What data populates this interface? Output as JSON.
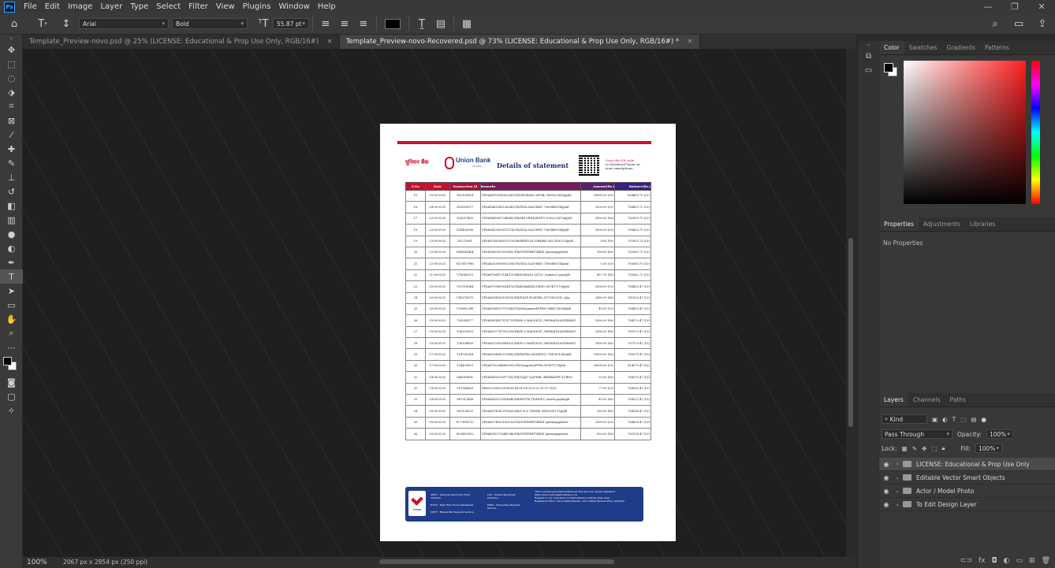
{
  "menu": [
    "File",
    "Edit",
    "Image",
    "Layer",
    "Type",
    "Select",
    "Filter",
    "View",
    "Plugins",
    "Window",
    "Help"
  ],
  "options": {
    "font_family": "Arial",
    "font_style": "Bold",
    "font_size": "55.87 pt"
  },
  "tabs": [
    {
      "label": "Template_Preview-novo.psd @ 25% (LICENSE: Educational & Prop Use Only, RGB/16#)",
      "active": false
    },
    {
      "label": "Template_Preview-novo-Recovered.psd @ 73% (LICENSE: Educational & Prop Use Only, RGB/16#) *",
      "active": true
    }
  ],
  "status": {
    "zoom": "100%",
    "doc_info": "2067 px x 2854 px (250 ppi)"
  },
  "statement": {
    "bank_hindi": "यूनियन बैंक",
    "bank_en": "Union Bank",
    "bank_en_sub": "of India",
    "title": "Details of statement",
    "qr_line1": "Scan the QR code",
    "qr_line2": "to download Vyom on",
    "qr_line3": "your smartphone",
    "headers": [
      "S.No",
      "Date",
      "Transaction Id",
      "Remarks",
      "Amount(Rs.)",
      "Balance(Rs.)"
    ],
    "rows": [
      [
        "15",
        "25-08-2025",
        "X50100814",
        "UPIAR/090104282941/CR/VENKATA /APGB/ 9989229618@ybl",
        "50000.00 (Cr)",
        "834455.73 (Cr)"
      ],
      [
        "16",
        "24-08-2025",
        "X29859517",
        "UPIAR/485545136543/CR/SIVA SAI/UBIN/ 7569488514@axl",
        "1500.00 (Cr)",
        "784455.73 (Cr)"
      ],
      [
        "17",
        "23-08-2025",
        "X28357400",
        "UPIAR/849067248441/DR/SRI VENK/HDFC/ 6302233076@ybl",
        "5500.00 (Dr)",
        "782955.73 (Cr)"
      ],
      [
        "18",
        "23-08-2025",
        "X28492096",
        "UPIAR/453509031114/CR/SIVA SAI/UBIN/ 7569488514@ybl",
        "5500.00 (Cr)",
        "788455.73 (Cr)"
      ],
      [
        "19",
        "23-08-2025",
        "X5275361",
        "UPIAR/746148015379/DR/MERUVA V/BARB/ Q427436733@ybl",
        "8.00 (Dr)",
        "782955.73 (Cr)"
      ],
      [
        "20",
        "22-08-2025",
        "W46048404",
        "UPIAR/985929095492/DR/GOPISHET/BKID /paramgopishet",
        "100.00 (Dr)",
        "782963.73 (Cr)"
      ],
      [
        "21",
        "22-08-2025",
        "W37497986",
        "UPIAR/353908051508/CR/SIVA SAI/UBIN/ 7569488514@axl",
        "1.00 (Cr)",
        "783063.73 (Cr)"
      ],
      [
        "22",
        "21-08-2025",
        "V78045915",
        "UPIAR/766872144513/DR/ZOMATO L/ICIC /zomato1 payu@b",
        "457.76 (Dr)",
        "783062.73 (Cr)"
      ],
      [
        "23",
        "20-08-2025",
        "V53116944",
        "UPIAR/793809504475/CR/KORAPATI/UBIN/ 867497275@ybl",
        "2500.00 (Cr)",
        "784420.47 (Cr)"
      ],
      [
        "24",
        "20-08-2025",
        "U40374375",
        "UPIAR/594350118109/DR/DILIP KU/KVBL /8179823142-2@y",
        "2490.00 (Dr)",
        "781920.47 (Cr)"
      ],
      [
        "25",
        "20-08-2025",
        "U38092389",
        "UPIAR/548317579543/CR/Mohammed/PPIW/ 8884728564@ib",
        "45.00 (Cr)",
        "784415.47 (Cr)"
      ],
      [
        "26",
        "19-08-2025",
        "T28240377",
        "UPIAR/854857874715/DR/M S MAIN/ICIC /MSMAINLANDHANG",
        "1000.00 (Dr)",
        "784370.47 (Cr)"
      ],
      [
        "27",
        "19-08-2025",
        "T26220583",
        "UPIAR/537747592239/DR/M S MAIN/ICIC /MSMAINLANDHANG",
        "2000.00 (Dr)",
        "785370.47 (Cr)"
      ],
      [
        "28",
        "18-08-2025",
        "T26198806",
        "UPIAR/513956494552/DR/M S MAIN/ICIC /MSMAINLANDHANG",
        "2000.00 (Dr)",
        "787370.47 (Cr)"
      ],
      [
        "29",
        "17-08-2025",
        "T24700244",
        "UPIAR/394969213482/DR/PATHA MO/HDFC/ 7842831045@ib",
        "25000.00 (Dr)",
        "789370.47 (Cr)"
      ],
      [
        "30",
        "17-08-2025",
        "T24459653",
        "UPIAR/762244686595/CR/Garapati/APGB/ 867497274@ib",
        "30000.00 (Cr)",
        "814370.47 (Cr)"
      ],
      [
        "31",
        "14-08-2025",
        "S66560491",
        "UPIAR/416136477562/DR/VIJAY SA/FDRL /BHARATPE SUBDO",
        "20.00 (Dr)",
        "784370.47 (Cr)"
      ],
      [
        "32",
        "14-08-2025",
        "Y51146863",
        "188612030002308:Int.Pd:01-06-2025 to 31-07-2025",
        "77.00 (Cr)",
        "784390.47 (Cr)"
      ],
      [
        "33",
        "14-08-2025",
        "X87912488",
        "UPIAR/089211414640/DR/PAYTM TR/HDFC /travel.paytm@h",
        "45.00 (Dr)",
        "784313.47 (Cr)"
      ],
      [
        "34",
        "09-08-2025",
        "X59128525",
        "UPIAR/914242976055/DR/S R & T/ESIB/ QE00030172@ybl",
        "300.00 (Dr)",
        "784358.47 (Cr)"
      ],
      [
        "35",
        "09-08-2025",
        "W77898712",
        "UPIAR/574903185150/CR/GOPISHET/BKID /paramgopishet",
        "2500.00 (Cr)",
        "784658.47 (Cr)"
      ],
      [
        "36",
        "09-08-2025",
        "W39450052",
        "UPIAR/542176440246/DR/GOPISHET/BKID /paramgopishet",
        "500.00 (Dr)",
        "782158.47 (Cr)"
      ]
    ],
    "footer": {
      "logo_text": "VYOM",
      "col1": [
        "NEFT - National Electronic Fund Transfer",
        "RTGS - Real Time Gross Settlement",
        "NEFT - Bharat Bill Payment Service"
      ],
      "col2": [
        "UPI - Unified Payments Interface",
        "IMPS - Immediate Payment Service"
      ],
      "col3": [
        "This is system generated statement and does not require signature",
        "https://www.unionbankofindia.co.in",
        "Request to our customers for immediately notifying their dues",
        "Registered office: Union Bank Bhavan, 239, Vidhan Bhavan Marg, Mumbai"
      ]
    }
  },
  "panels": {
    "color_tabs": [
      "Color",
      "Swatches",
      "Gradients",
      "Patterns"
    ],
    "props_tabs": [
      "Properties",
      "Adjustments",
      "Libraries"
    ],
    "props_text": "No Properties",
    "layers_tabs": [
      "Layers",
      "Channels",
      "Paths"
    ],
    "kind": "Kind",
    "blend": "Pass Through",
    "opacity_label": "Opacity:",
    "opacity": "100%",
    "lock_label": "Lock:",
    "fill_label": "Fill:",
    "fill": "100%",
    "layers": [
      "LICENSE: Educational & Prop Use Only",
      "Editable Vector Smart Objects",
      "Actor / Model Photo",
      "To Edit Design Layer"
    ]
  },
  "colors": {
    "accent_red": "#c8102e",
    "header_blue": "#1a2a7a",
    "footer_blue": "#1f3c88"
  }
}
